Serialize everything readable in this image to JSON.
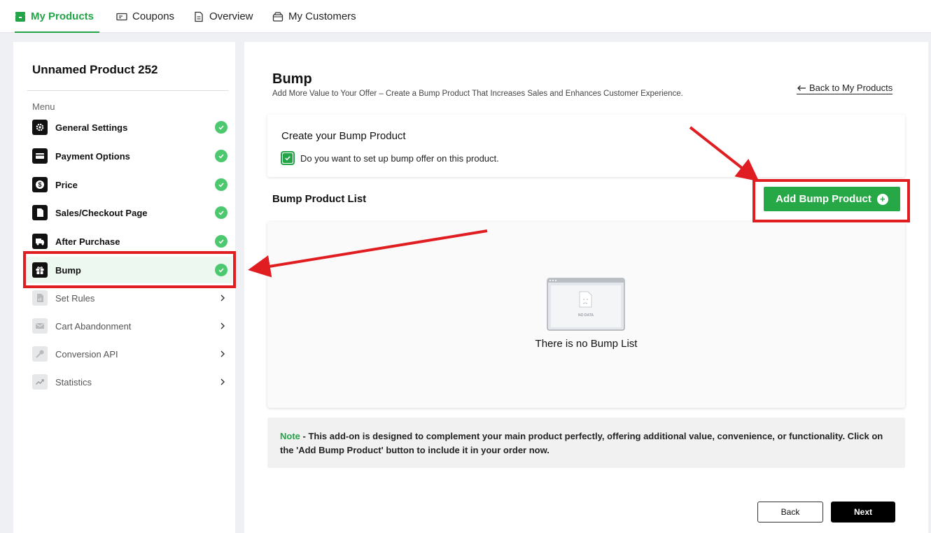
{
  "topnav": {
    "tabs": [
      {
        "label": "My Products",
        "icon": "store-icon",
        "active": true
      },
      {
        "label": "Coupons",
        "icon": "ticket-icon",
        "active": false
      },
      {
        "label": "Overview",
        "icon": "document-icon",
        "active": false
      },
      {
        "label": "My Customers",
        "icon": "wallet-icon",
        "active": false
      }
    ],
    "accent_color": "#22a447"
  },
  "sidebar": {
    "product_title": "Unnamed Product 252",
    "menu_label": "Menu",
    "items": [
      {
        "label": "General Settings",
        "icon": "gear-icon",
        "status": "complete"
      },
      {
        "label": "Payment Options",
        "icon": "card-icon",
        "status": "complete"
      },
      {
        "label": "Price",
        "icon": "dollar-icon",
        "status": "complete"
      },
      {
        "label": "Sales/Checkout Page",
        "icon": "page-icon",
        "status": "complete"
      },
      {
        "label": "After Purchase",
        "icon": "truck-icon",
        "status": "complete"
      },
      {
        "label": "Bump",
        "icon": "gift-icon",
        "status": "complete",
        "active": true
      },
      {
        "label": "Set Rules",
        "icon": "rules-icon",
        "status": "locked"
      },
      {
        "label": "Cart Abandonment",
        "icon": "mail-icon",
        "status": "locked"
      },
      {
        "label": "Conversion API",
        "icon": "key-icon",
        "status": "locked"
      },
      {
        "label": "Statistics",
        "icon": "trend-icon",
        "status": "locked"
      }
    ]
  },
  "main": {
    "title": "Bump",
    "subtitle": "Add More Value to Your Offer – Create a Bump Product That Increases Sales and Enhances Customer Experience.",
    "back_link": "Back to My Products",
    "create": {
      "title": "Create your Bump Product",
      "checkbox_label": "Do you want to set up bump offer on this product.",
      "checked": true
    },
    "list_title": "Bump Product List",
    "add_button": "Add Bump Product",
    "empty": {
      "illustration_text": "NO DATA",
      "message": "There is no Bump List"
    },
    "note": {
      "label": "Note",
      "text": " - This add-on is designed to complement your main product perfectly, offering additional value, convenience, or functionality. Click on the 'Add Bump Product' button to include it in your order now."
    },
    "buttons": {
      "back": "Back",
      "next": "Next"
    }
  },
  "annotation_color": "#e01e22"
}
